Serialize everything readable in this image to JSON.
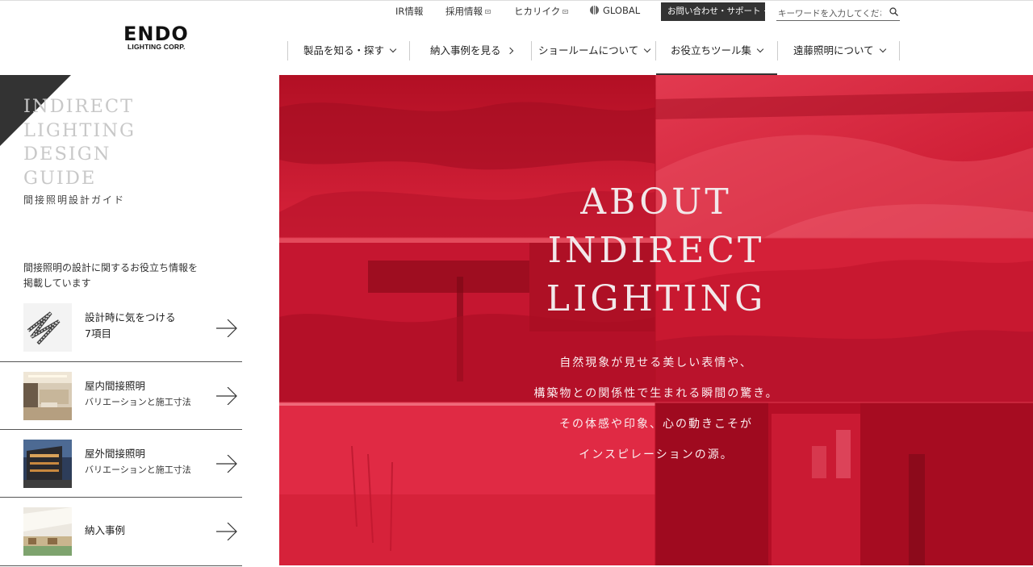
{
  "header": {
    "logo_main": "ENDO",
    "logo_sub": "LIGHTING CORP.",
    "util_links": [
      "IR情報",
      "採用情報",
      "ヒカリイク"
    ],
    "global_label": "GLOBAL",
    "contact_label": "お問い合わせ・サポート",
    "search_placeholder": "キーワードを入力してください",
    "nav": [
      {
        "label": "製品を知る・探す"
      },
      {
        "label": "納入事例を見る"
      },
      {
        "label": "ショールームについて"
      },
      {
        "label": "お役立ちツール集"
      },
      {
        "label": "遠藤照明について"
      }
    ]
  },
  "sidebar": {
    "title": "INDIRECT\nLIGHTING\nDESIGN\nGUIDE",
    "subtitle": "間接照明設計ガイド",
    "intro_line1": "間接照明の設計に関するお役立ち情報を",
    "intro_line2": "掲載しています",
    "items": [
      {
        "line1": "設計時に気をつける",
        "line2": "7項目",
        "thumb": "ruler-icon"
      },
      {
        "line1": "屋内間接照明",
        "line2": "バリエーションと施工寸法",
        "thumb": "interior-photo"
      },
      {
        "line1": "屋外間接照明",
        "line2": "バリエーションと施工寸法",
        "thumb": "exterior-photo"
      },
      {
        "line1": "納入事例",
        "line2": "",
        "thumb": "case-photo"
      }
    ]
  },
  "hero": {
    "title": "ABOUT\nINDIRECT\nLIGHTING",
    "copy": [
      "自然現象が見せる美しい表情や、",
      "構築物との関係性で生まれる瞬間の驚き。",
      "その体感や印象、心の動きこそが",
      "インスピレーションの源。"
    ],
    "overlay_color": "#c9142b"
  }
}
